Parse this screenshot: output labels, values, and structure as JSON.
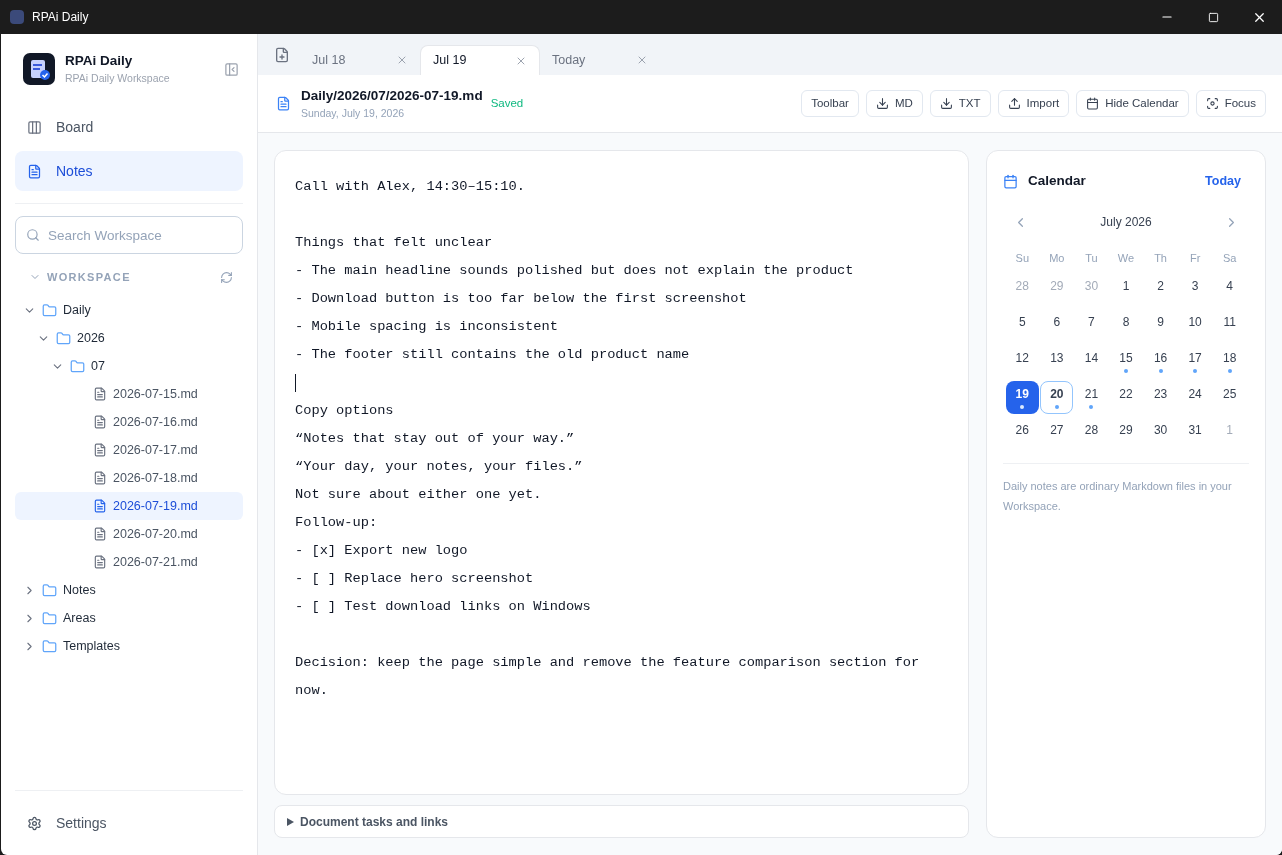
{
  "window": {
    "title": "RPAi Daily"
  },
  "sidebar": {
    "app_name": "RPAi Daily",
    "workspace_name": "RPAi Daily Workspace",
    "nav": [
      {
        "label": "Board",
        "kind": "board",
        "selected": false
      },
      {
        "label": "Notes",
        "kind": "notes",
        "selected": true
      }
    ],
    "search": {
      "placeholder": "Search Workspace"
    },
    "section": {
      "label": "WORKSPACE",
      "expanded": true
    },
    "tree": [
      {
        "name": "Daily",
        "kind": "folder",
        "expanded": true,
        "selected": false,
        "children": [
          {
            "name": "2026",
            "kind": "folder",
            "expanded": true,
            "selected": false,
            "children": [
              {
                "name": "07",
                "kind": "folder",
                "expanded": true,
                "selected": false,
                "children": [
                  {
                    "name": "2026-07-15.md",
                    "kind": "file",
                    "selected": false
                  },
                  {
                    "name": "2026-07-16.md",
                    "kind": "file",
                    "selected": false
                  },
                  {
                    "name": "2026-07-17.md",
                    "kind": "file",
                    "selected": false
                  },
                  {
                    "name": "2026-07-18.md",
                    "kind": "file",
                    "selected": false
                  },
                  {
                    "name": "2026-07-19.md",
                    "kind": "file",
                    "selected": true
                  },
                  {
                    "name": "2026-07-20.md",
                    "kind": "file",
                    "selected": false
                  },
                  {
                    "name": "2026-07-21.md",
                    "kind": "file",
                    "selected": false
                  }
                ]
              }
            ]
          }
        ]
      },
      {
        "name": "Notes",
        "kind": "folder",
        "expanded": false,
        "selected": false
      },
      {
        "name": "Areas",
        "kind": "folder",
        "expanded": false,
        "selected": false
      },
      {
        "name": "Templates",
        "kind": "folder",
        "expanded": false,
        "selected": false
      }
    ],
    "settings": "Settings"
  },
  "tabs": [
    {
      "label": "Jul 18",
      "selected": false
    },
    {
      "label": "Jul 19",
      "selected": true
    },
    {
      "label": "Today",
      "selected": false
    }
  ],
  "document": {
    "path": "Daily/2026/07/2026-07-19.md",
    "date": "Sunday, July 19, 2026",
    "status": "Saved"
  },
  "toolbar": [
    {
      "label": "Toolbar",
      "kind": "plain"
    },
    {
      "label": "MD",
      "kind": "download"
    },
    {
      "label": "TXT",
      "kind": "download"
    },
    {
      "label": "Import",
      "kind": "upload"
    },
    {
      "label": "Hide Calendar",
      "kind": "calendar"
    },
    {
      "label": "Focus",
      "kind": "focus"
    }
  ],
  "editor": {
    "lines": [
      {
        "kind": "text",
        "text": "Call with Alex, 14:30–15:10."
      },
      {
        "kind": "blank"
      },
      {
        "kind": "text",
        "text": "Things that felt unclear"
      },
      {
        "kind": "text",
        "text": "- The main headline sounds polished but does not explain the product"
      },
      {
        "kind": "text",
        "text": "- Download button is too far below the first screenshot"
      },
      {
        "kind": "text",
        "text": "- Mobile spacing is inconsistent"
      },
      {
        "kind": "text",
        "text": "- The footer still contains the old product name"
      },
      {
        "kind": "cursor"
      },
      {
        "kind": "text",
        "text": "Copy options"
      },
      {
        "kind": "text",
        "text": "“Notes that stay out of your way.”"
      },
      {
        "kind": "text",
        "text": "“Your day, your notes, your files.”"
      },
      {
        "kind": "text",
        "text": "Not sure about either one yet."
      },
      {
        "kind": "text",
        "text": "Follow-up:"
      },
      {
        "kind": "text",
        "text": "- [x] Export new logo"
      },
      {
        "kind": "text",
        "text": "- [ ] Replace hero screenshot"
      },
      {
        "kind": "text",
        "text": "- [ ] Test download links on Windows"
      },
      {
        "kind": "blank"
      },
      {
        "kind": "text",
        "text": "Decision: keep the page simple and remove the feature comparison section for now."
      }
    ]
  },
  "details": {
    "label": "Document tasks and links",
    "expanded": false
  },
  "calendar": {
    "title": "Calendar",
    "today_button": "Today",
    "month": "July 2026",
    "weekdays": [
      "Su",
      "Mo",
      "Tu",
      "We",
      "Th",
      "Fr",
      "Sa"
    ],
    "days": [
      {
        "text": "28",
        "outside": true,
        "selected": false,
        "today": false,
        "has_note": false
      },
      {
        "text": "29",
        "outside": true,
        "selected": false,
        "today": false,
        "has_note": false
      },
      {
        "text": "30",
        "outside": true,
        "selected": false,
        "today": false,
        "has_note": false
      },
      {
        "text": "1",
        "outside": false,
        "selected": false,
        "today": false,
        "has_note": false
      },
      {
        "text": "2",
        "outside": false,
        "selected": false,
        "today": false,
        "has_note": false
      },
      {
        "text": "3",
        "outside": false,
        "selected": false,
        "today": false,
        "has_note": false
      },
      {
        "text": "4",
        "outside": false,
        "selected": false,
        "today": false,
        "has_note": false
      },
      {
        "text": "5",
        "outside": false,
        "selected": false,
        "today": false,
        "has_note": false
      },
      {
        "text": "6",
        "outside": false,
        "selected": false,
        "today": false,
        "has_note": false
      },
      {
        "text": "7",
        "outside": false,
        "selected": false,
        "today": false,
        "has_note": false
      },
      {
        "text": "8",
        "outside": false,
        "selected": false,
        "today": false,
        "has_note": false
      },
      {
        "text": "9",
        "outside": false,
        "selected": false,
        "today": false,
        "has_note": false
      },
      {
        "text": "10",
        "outside": false,
        "selected": false,
        "today": false,
        "has_note": false
      },
      {
        "text": "11",
        "outside": false,
        "selected": false,
        "today": false,
        "has_note": false
      },
      {
        "text": "12",
        "outside": false,
        "selected": false,
        "today": false,
        "has_note": false
      },
      {
        "text": "13",
        "outside": false,
        "selected": false,
        "today": false,
        "has_note": false
      },
      {
        "text": "14",
        "outside": false,
        "selected": false,
        "today": false,
        "has_note": false
      },
      {
        "text": "15",
        "outside": false,
        "selected": false,
        "today": false,
        "has_note": true
      },
      {
        "text": "16",
        "outside": false,
        "selected": false,
        "today": false,
        "has_note": true
      },
      {
        "text": "17",
        "outside": false,
        "selected": false,
        "today": false,
        "has_note": true
      },
      {
        "text": "18",
        "outside": false,
        "selected": false,
        "today": false,
        "has_note": true
      },
      {
        "text": "19",
        "outside": false,
        "selected": true,
        "today": false,
        "has_note": true
      },
      {
        "text": "20",
        "outside": false,
        "selected": false,
        "today": true,
        "has_note": true
      },
      {
        "text": "21",
        "outside": false,
        "selected": false,
        "today": false,
        "has_note": true
      },
      {
        "text": "22",
        "outside": false,
        "selected": false,
        "today": false,
        "has_note": false
      },
      {
        "text": "23",
        "outside": false,
        "selected": false,
        "today": false,
        "has_note": false
      },
      {
        "text": "24",
        "outside": false,
        "selected": false,
        "today": false,
        "has_note": false
      },
      {
        "text": "25",
        "outside": false,
        "selected": false,
        "today": false,
        "has_note": false
      },
      {
        "text": "26",
        "outside": false,
        "selected": false,
        "today": false,
        "has_note": false
      },
      {
        "text": "27",
        "outside": false,
        "selected": false,
        "today": false,
        "has_note": false
      },
      {
        "text": "28",
        "outside": false,
        "selected": false,
        "today": false,
        "has_note": false
      },
      {
        "text": "29",
        "outside": false,
        "selected": false,
        "today": false,
        "has_note": false
      },
      {
        "text": "30",
        "outside": false,
        "selected": false,
        "today": false,
        "has_note": false
      },
      {
        "text": "31",
        "outside": false,
        "selected": false,
        "today": false,
        "has_note": false
      },
      {
        "text": "1",
        "outside": true,
        "selected": false,
        "today": false,
        "has_note": false
      }
    ],
    "footnote": "Daily notes are ordinary Markdown files in your Workspace."
  }
}
